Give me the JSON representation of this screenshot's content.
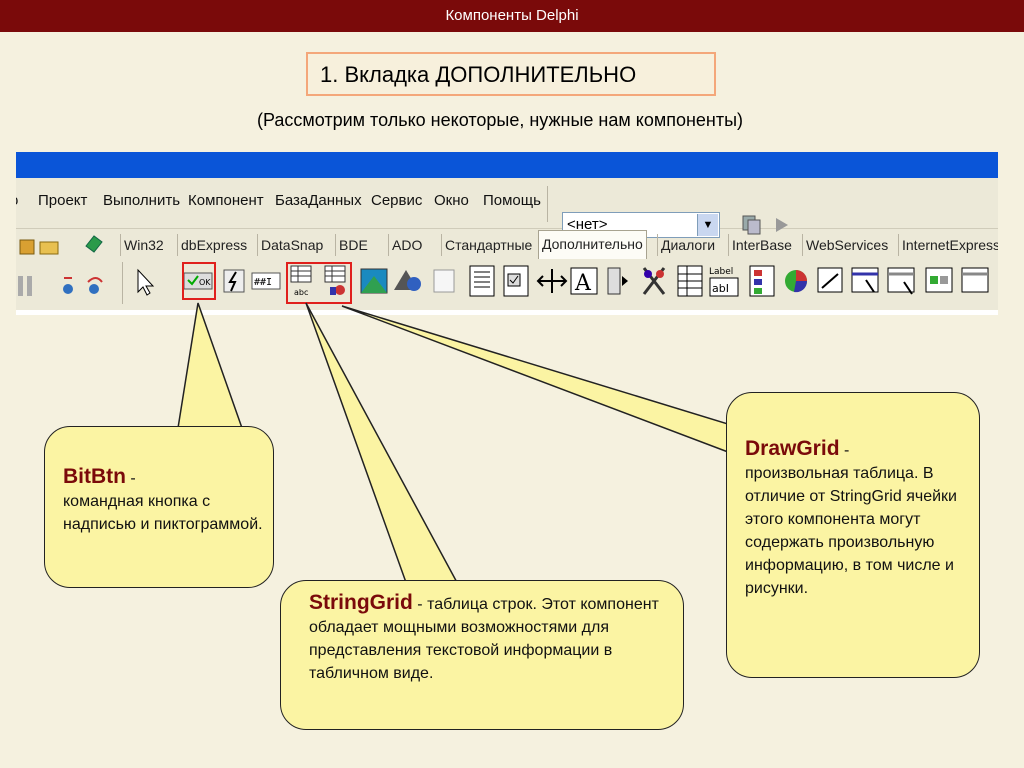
{
  "header": {
    "title": "Компоненты Delphi"
  },
  "slide_title": "1. Вкладка ДОПОЛНИТЕЛЬНО",
  "subtitle": "(Рассмотрим только некоторые, нужные нам компоненты)",
  "ide": {
    "menu": [
      "Проект",
      "Выполнить",
      "Компонент",
      "БазаДанных",
      "Сервис",
      "Окно",
      "Помощь"
    ],
    "combo_value": "<нет>",
    "tabs": [
      "Win32",
      "dbExpress",
      "DataSnap",
      "BDE",
      "ADO",
      "Стандартные",
      "Дополнительно",
      "Диалоги",
      "InterBase",
      "WebServices",
      "InternetExpress"
    ],
    "active_tab": "Дополнительно",
    "label_component_text": "Label"
  },
  "callouts": {
    "bitbtn": {
      "name": "BitBtn",
      "dash": " -",
      "text": "командная кнопка с надписью и пиктограммой."
    },
    "stringgrid": {
      "name": "StringGrid",
      "dash": " -",
      "text": "таблица строк. Этот компонент обладает мощными возможностями для представления текстовой информации в табличном виде."
    },
    "drawgrid": {
      "name": "DrawGrid",
      "dash": " -",
      "text": "произвольная таблица. В отличие от StringGrid ячейки этого компонента могут содержать произвольную информацию, в том числе и рисунки."
    }
  },
  "colors": {
    "header_bg": "#7a0a0a",
    "accent_text": "#7a0a0a",
    "bubble_bg": "#fbf4a3",
    "ide_blue": "#0a55d8"
  }
}
